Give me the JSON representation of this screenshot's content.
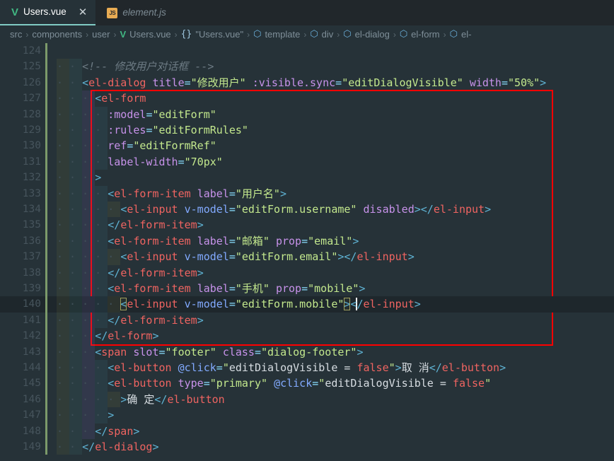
{
  "tabs": [
    {
      "label": "Users.vue",
      "icon": "vue-icon",
      "active": true,
      "close_label": "✕"
    },
    {
      "label": "element.js",
      "icon": "js-icon",
      "icon_text": "JS",
      "active": false
    }
  ],
  "breadcrumb": [
    {
      "label": "src",
      "icon": null
    },
    {
      "label": "components",
      "icon": null
    },
    {
      "label": "user",
      "icon": null
    },
    {
      "label": "Users.vue",
      "icon": "vue-file-icon"
    },
    {
      "label": "\"Users.vue\"",
      "icon": "braces-icon"
    },
    {
      "label": "template",
      "icon": "cube-icon"
    },
    {
      "label": "div",
      "icon": "cube-icon"
    },
    {
      "label": "el-dialog",
      "icon": "cube-icon"
    },
    {
      "label": "el-form",
      "icon": "cube-icon"
    },
    {
      "label": "el-",
      "icon": "cube-icon"
    }
  ],
  "breadcrumb_separator": "›",
  "editor": {
    "first_visible_line": 124,
    "active_line": 140,
    "language": "vue",
    "lines": [
      {
        "n": 124,
        "indent": 0,
        "tokens": []
      },
      {
        "n": 125,
        "indent": 2,
        "tokens": [
          {
            "c": "comment",
            "t": "<!-- 修改用户对话框 -->"
          }
        ]
      },
      {
        "n": 126,
        "indent": 2,
        "tokens": [
          {
            "c": "punct",
            "t": "<"
          },
          {
            "c": "tag",
            "t": "el-dialog"
          },
          {
            "c": "text",
            "t": " "
          },
          {
            "c": "attr",
            "t": "title"
          },
          {
            "c": "eq",
            "t": "="
          },
          {
            "c": "str",
            "t": "\"修改用户\""
          },
          {
            "c": "text",
            "t": " "
          },
          {
            "c": "attr",
            "t": ":visible.sync"
          },
          {
            "c": "eq",
            "t": "="
          },
          {
            "c": "str",
            "t": "\"editDialogVisible\""
          },
          {
            "c": "text",
            "t": " "
          },
          {
            "c": "attr",
            "t": "width"
          },
          {
            "c": "eq",
            "t": "="
          },
          {
            "c": "str",
            "t": "\"50%\""
          },
          {
            "c": "punct",
            "t": ">"
          }
        ]
      },
      {
        "n": 127,
        "indent": 3,
        "tokens": [
          {
            "c": "punct",
            "t": "<"
          },
          {
            "c": "tag",
            "t": "el-form"
          }
        ]
      },
      {
        "n": 128,
        "indent": 4,
        "tokens": [
          {
            "c": "attr",
            "t": ":model"
          },
          {
            "c": "eq",
            "t": "="
          },
          {
            "c": "str",
            "t": "\"editForm\""
          }
        ]
      },
      {
        "n": 129,
        "indent": 4,
        "tokens": [
          {
            "c": "attr",
            "t": ":rules"
          },
          {
            "c": "eq",
            "t": "="
          },
          {
            "c": "str",
            "t": "\"editFormRules\""
          }
        ]
      },
      {
        "n": 130,
        "indent": 4,
        "tokens": [
          {
            "c": "attr",
            "t": "ref"
          },
          {
            "c": "eq",
            "t": "="
          },
          {
            "c": "str",
            "t": "\"editFormRef\""
          }
        ]
      },
      {
        "n": 131,
        "indent": 4,
        "tokens": [
          {
            "c": "attr",
            "t": "label-width"
          },
          {
            "c": "eq",
            "t": "="
          },
          {
            "c": "str",
            "t": "\"70px\""
          }
        ]
      },
      {
        "n": 132,
        "indent": 3,
        "tokens": [
          {
            "c": "punct",
            "t": ">"
          }
        ]
      },
      {
        "n": 133,
        "indent": 4,
        "tokens": [
          {
            "c": "punct",
            "t": "<"
          },
          {
            "c": "tag",
            "t": "el-form-item"
          },
          {
            "c": "text",
            "t": " "
          },
          {
            "c": "attr",
            "t": "label"
          },
          {
            "c": "eq",
            "t": "="
          },
          {
            "c": "str",
            "t": "\"用户名\""
          },
          {
            "c": "punct",
            "t": ">"
          }
        ]
      },
      {
        "n": 134,
        "indent": 5,
        "tokens": [
          {
            "c": "punct",
            "t": "<"
          },
          {
            "c": "tag",
            "t": "el-input"
          },
          {
            "c": "text",
            "t": " "
          },
          {
            "c": "attr2",
            "t": "v-model"
          },
          {
            "c": "eq",
            "t": "="
          },
          {
            "c": "str",
            "t": "\"editForm.username\""
          },
          {
            "c": "text",
            "t": " "
          },
          {
            "c": "attr",
            "t": "disabled"
          },
          {
            "c": "punct",
            "t": ">"
          },
          {
            "c": "punct",
            "t": "</"
          },
          {
            "c": "tag",
            "t": "el-input"
          },
          {
            "c": "punct",
            "t": ">"
          }
        ]
      },
      {
        "n": 135,
        "indent": 4,
        "tokens": [
          {
            "c": "punct",
            "t": "</"
          },
          {
            "c": "tag",
            "t": "el-form-item"
          },
          {
            "c": "punct",
            "t": ">"
          }
        ]
      },
      {
        "n": 136,
        "indent": 4,
        "tokens": [
          {
            "c": "punct",
            "t": "<"
          },
          {
            "c": "tag",
            "t": "el-form-item"
          },
          {
            "c": "text",
            "t": " "
          },
          {
            "c": "attr",
            "t": "label"
          },
          {
            "c": "eq",
            "t": "="
          },
          {
            "c": "str",
            "t": "\"邮箱\""
          },
          {
            "c": "text",
            "t": " "
          },
          {
            "c": "attr",
            "t": "prop"
          },
          {
            "c": "eq",
            "t": "="
          },
          {
            "c": "str",
            "t": "\"email\""
          },
          {
            "c": "punct",
            "t": ">"
          }
        ]
      },
      {
        "n": 137,
        "indent": 5,
        "tokens": [
          {
            "c": "punct",
            "t": "<"
          },
          {
            "c": "tag",
            "t": "el-input"
          },
          {
            "c": "text",
            "t": " "
          },
          {
            "c": "attr2",
            "t": "v-model"
          },
          {
            "c": "eq",
            "t": "="
          },
          {
            "c": "str",
            "t": "\"editForm.email\""
          },
          {
            "c": "punct",
            "t": ">"
          },
          {
            "c": "punct",
            "t": "</"
          },
          {
            "c": "tag",
            "t": "el-input"
          },
          {
            "c": "punct",
            "t": ">"
          }
        ]
      },
      {
        "n": 138,
        "indent": 4,
        "tokens": [
          {
            "c": "punct",
            "t": "</"
          },
          {
            "c": "tag",
            "t": "el-form-item"
          },
          {
            "c": "punct",
            "t": ">"
          }
        ]
      },
      {
        "n": 139,
        "indent": 4,
        "tokens": [
          {
            "c": "punct",
            "t": "<"
          },
          {
            "c": "tag",
            "t": "el-form-item"
          },
          {
            "c": "text",
            "t": " "
          },
          {
            "c": "attr",
            "t": "label"
          },
          {
            "c": "eq",
            "t": "="
          },
          {
            "c": "str",
            "t": "\"手机\""
          },
          {
            "c": "text",
            "t": " "
          },
          {
            "c": "attr",
            "t": "prop"
          },
          {
            "c": "eq",
            "t": "="
          },
          {
            "c": "str",
            "t": "\"mobile\""
          },
          {
            "c": "punct",
            "t": ">"
          }
        ]
      },
      {
        "n": 140,
        "indent": 5,
        "tokens": [
          {
            "c": "punct bracket",
            "t": "<"
          },
          {
            "c": "tag",
            "t": "el-input"
          },
          {
            "c": "text",
            "t": " "
          },
          {
            "c": "attr2",
            "t": "v-model"
          },
          {
            "c": "eq",
            "t": "="
          },
          {
            "c": "str",
            "t": "\"editForm.mobile\""
          },
          {
            "c": "punct bracket cursor-after",
            "t": ">"
          },
          {
            "c": "punct",
            "t": "</"
          },
          {
            "c": "tag",
            "t": "el-input"
          },
          {
            "c": "punct",
            "t": ">"
          }
        ]
      },
      {
        "n": 141,
        "indent": 4,
        "tokens": [
          {
            "c": "punct",
            "t": "</"
          },
          {
            "c": "tag",
            "t": "el-form-item"
          },
          {
            "c": "punct",
            "t": ">"
          }
        ]
      },
      {
        "n": 142,
        "indent": 3,
        "tokens": [
          {
            "c": "punct",
            "t": "</"
          },
          {
            "c": "tag",
            "t": "el-form"
          },
          {
            "c": "punct",
            "t": ">"
          }
        ]
      },
      {
        "n": 143,
        "indent": 3,
        "tokens": [
          {
            "c": "punct",
            "t": "<"
          },
          {
            "c": "tag",
            "t": "span"
          },
          {
            "c": "text",
            "t": " "
          },
          {
            "c": "attr",
            "t": "slot"
          },
          {
            "c": "eq",
            "t": "="
          },
          {
            "c": "str",
            "t": "\"footer\""
          },
          {
            "c": "text",
            "t": " "
          },
          {
            "c": "attr",
            "t": "class"
          },
          {
            "c": "eq",
            "t": "="
          },
          {
            "c": "str",
            "t": "\"dialog-footer\""
          },
          {
            "c": "punct",
            "t": ">"
          }
        ]
      },
      {
        "n": 144,
        "indent": 4,
        "tokens": [
          {
            "c": "punct",
            "t": "<"
          },
          {
            "c": "tag",
            "t": "el-button"
          },
          {
            "c": "text",
            "t": " "
          },
          {
            "c": "attr2",
            "t": "@click"
          },
          {
            "c": "eq",
            "t": "="
          },
          {
            "c": "str",
            "t": "\""
          },
          {
            "c": "text",
            "t": "editDialogVisible = "
          },
          {
            "c": "kw",
            "t": "false"
          },
          {
            "c": "str",
            "t": "\""
          },
          {
            "c": "punct",
            "t": ">"
          },
          {
            "c": "text",
            "t": "取 消"
          },
          {
            "c": "punct",
            "t": "</"
          },
          {
            "c": "tag",
            "t": "el-button"
          },
          {
            "c": "punct",
            "t": ">"
          }
        ]
      },
      {
        "n": 145,
        "indent": 4,
        "tokens": [
          {
            "c": "punct",
            "t": "<"
          },
          {
            "c": "tag",
            "t": "el-button"
          },
          {
            "c": "text",
            "t": " "
          },
          {
            "c": "attr",
            "t": "type"
          },
          {
            "c": "eq",
            "t": "="
          },
          {
            "c": "str",
            "t": "\"primary\""
          },
          {
            "c": "text",
            "t": " "
          },
          {
            "c": "attr2",
            "t": "@click"
          },
          {
            "c": "eq",
            "t": "="
          },
          {
            "c": "str",
            "t": "\""
          },
          {
            "c": "text",
            "t": "editDialogVisible = "
          },
          {
            "c": "kw",
            "t": "false"
          },
          {
            "c": "str",
            "t": "\""
          }
        ]
      },
      {
        "n": 146,
        "indent": 5,
        "tokens": [
          {
            "c": "punct",
            "t": ">"
          },
          {
            "c": "text",
            "t": "确 定"
          },
          {
            "c": "punct",
            "t": "</"
          },
          {
            "c": "tag",
            "t": "el-button"
          }
        ]
      },
      {
        "n": 147,
        "indent": 4,
        "tokens": [
          {
            "c": "punct",
            "t": ">"
          }
        ]
      },
      {
        "n": 148,
        "indent": 3,
        "tokens": [
          {
            "c": "punct",
            "t": "</"
          },
          {
            "c": "tag",
            "t": "span"
          },
          {
            "c": "punct",
            "t": ">"
          }
        ]
      },
      {
        "n": 149,
        "indent": 2,
        "tokens": [
          {
            "c": "punct",
            "t": "</"
          },
          {
            "c": "tag",
            "t": "el-dialog"
          },
          {
            "c": "punct",
            "t": ">"
          }
        ]
      }
    ]
  },
  "annotation": {
    "shape": "rectangle",
    "color": "#fe0000",
    "covers_lines": "127-142"
  },
  "colors": {
    "background": "#263238",
    "tab_bar": "#21272b",
    "active_line": "#1e272c",
    "git_modified": "#7c9a6a",
    "accent": "#80cbc4",
    "vue_green": "#41b883",
    "annotation_red": "#fe0000"
  }
}
